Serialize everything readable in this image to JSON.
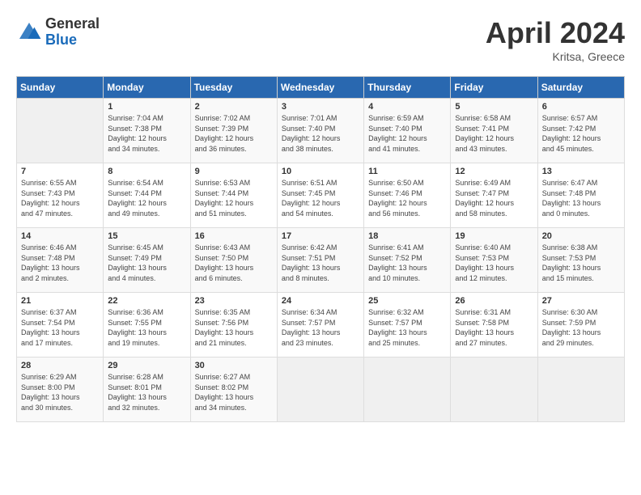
{
  "header": {
    "logo_general": "General",
    "logo_blue": "Blue",
    "month_year": "April 2024",
    "location": "Kritsa, Greece"
  },
  "days_of_week": [
    "Sunday",
    "Monday",
    "Tuesday",
    "Wednesday",
    "Thursday",
    "Friday",
    "Saturday"
  ],
  "weeks": [
    [
      {
        "day": "",
        "info": ""
      },
      {
        "day": "1",
        "info": "Sunrise: 7:04 AM\nSunset: 7:38 PM\nDaylight: 12 hours\nand 34 minutes."
      },
      {
        "day": "2",
        "info": "Sunrise: 7:02 AM\nSunset: 7:39 PM\nDaylight: 12 hours\nand 36 minutes."
      },
      {
        "day": "3",
        "info": "Sunrise: 7:01 AM\nSunset: 7:40 PM\nDaylight: 12 hours\nand 38 minutes."
      },
      {
        "day": "4",
        "info": "Sunrise: 6:59 AM\nSunset: 7:40 PM\nDaylight: 12 hours\nand 41 minutes."
      },
      {
        "day": "5",
        "info": "Sunrise: 6:58 AM\nSunset: 7:41 PM\nDaylight: 12 hours\nand 43 minutes."
      },
      {
        "day": "6",
        "info": "Sunrise: 6:57 AM\nSunset: 7:42 PM\nDaylight: 12 hours\nand 45 minutes."
      }
    ],
    [
      {
        "day": "7",
        "info": "Sunrise: 6:55 AM\nSunset: 7:43 PM\nDaylight: 12 hours\nand 47 minutes."
      },
      {
        "day": "8",
        "info": "Sunrise: 6:54 AM\nSunset: 7:44 PM\nDaylight: 12 hours\nand 49 minutes."
      },
      {
        "day": "9",
        "info": "Sunrise: 6:53 AM\nSunset: 7:44 PM\nDaylight: 12 hours\nand 51 minutes."
      },
      {
        "day": "10",
        "info": "Sunrise: 6:51 AM\nSunset: 7:45 PM\nDaylight: 12 hours\nand 54 minutes."
      },
      {
        "day": "11",
        "info": "Sunrise: 6:50 AM\nSunset: 7:46 PM\nDaylight: 12 hours\nand 56 minutes."
      },
      {
        "day": "12",
        "info": "Sunrise: 6:49 AM\nSunset: 7:47 PM\nDaylight: 12 hours\nand 58 minutes."
      },
      {
        "day": "13",
        "info": "Sunrise: 6:47 AM\nSunset: 7:48 PM\nDaylight: 13 hours\nand 0 minutes."
      }
    ],
    [
      {
        "day": "14",
        "info": "Sunrise: 6:46 AM\nSunset: 7:48 PM\nDaylight: 13 hours\nand 2 minutes."
      },
      {
        "day": "15",
        "info": "Sunrise: 6:45 AM\nSunset: 7:49 PM\nDaylight: 13 hours\nand 4 minutes."
      },
      {
        "day": "16",
        "info": "Sunrise: 6:43 AM\nSunset: 7:50 PM\nDaylight: 13 hours\nand 6 minutes."
      },
      {
        "day": "17",
        "info": "Sunrise: 6:42 AM\nSunset: 7:51 PM\nDaylight: 13 hours\nand 8 minutes."
      },
      {
        "day": "18",
        "info": "Sunrise: 6:41 AM\nSunset: 7:52 PM\nDaylight: 13 hours\nand 10 minutes."
      },
      {
        "day": "19",
        "info": "Sunrise: 6:40 AM\nSunset: 7:53 PM\nDaylight: 13 hours\nand 12 minutes."
      },
      {
        "day": "20",
        "info": "Sunrise: 6:38 AM\nSunset: 7:53 PM\nDaylight: 13 hours\nand 15 minutes."
      }
    ],
    [
      {
        "day": "21",
        "info": "Sunrise: 6:37 AM\nSunset: 7:54 PM\nDaylight: 13 hours\nand 17 minutes."
      },
      {
        "day": "22",
        "info": "Sunrise: 6:36 AM\nSunset: 7:55 PM\nDaylight: 13 hours\nand 19 minutes."
      },
      {
        "day": "23",
        "info": "Sunrise: 6:35 AM\nSunset: 7:56 PM\nDaylight: 13 hours\nand 21 minutes."
      },
      {
        "day": "24",
        "info": "Sunrise: 6:34 AM\nSunset: 7:57 PM\nDaylight: 13 hours\nand 23 minutes."
      },
      {
        "day": "25",
        "info": "Sunrise: 6:32 AM\nSunset: 7:57 PM\nDaylight: 13 hours\nand 25 minutes."
      },
      {
        "day": "26",
        "info": "Sunrise: 6:31 AM\nSunset: 7:58 PM\nDaylight: 13 hours\nand 27 minutes."
      },
      {
        "day": "27",
        "info": "Sunrise: 6:30 AM\nSunset: 7:59 PM\nDaylight: 13 hours\nand 29 minutes."
      }
    ],
    [
      {
        "day": "28",
        "info": "Sunrise: 6:29 AM\nSunset: 8:00 PM\nDaylight: 13 hours\nand 30 minutes."
      },
      {
        "day": "29",
        "info": "Sunrise: 6:28 AM\nSunset: 8:01 PM\nDaylight: 13 hours\nand 32 minutes."
      },
      {
        "day": "30",
        "info": "Sunrise: 6:27 AM\nSunset: 8:02 PM\nDaylight: 13 hours\nand 34 minutes."
      },
      {
        "day": "",
        "info": ""
      },
      {
        "day": "",
        "info": ""
      },
      {
        "day": "",
        "info": ""
      },
      {
        "day": "",
        "info": ""
      }
    ]
  ]
}
